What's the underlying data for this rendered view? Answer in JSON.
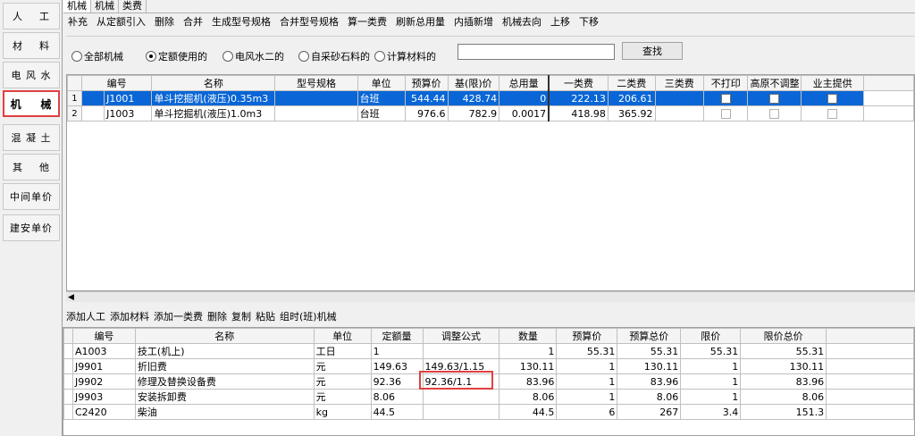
{
  "sidebar": {
    "items": [
      {
        "label": "人    工",
        "active": false
      },
      {
        "label": "材    料",
        "active": false
      },
      {
        "label": "电 风 水",
        "active": false
      },
      {
        "label": "机    械",
        "active": true
      },
      {
        "label": "混 凝 土",
        "active": false
      },
      {
        "label": "其    他",
        "active": false
      },
      {
        "label": "中间单价",
        "active": false
      },
      {
        "label": "建安单价",
        "active": false
      }
    ]
  },
  "tabs": [
    "机械",
    "机械",
    "类费"
  ],
  "toolbar": [
    "补充",
    "从定额引入",
    "删除",
    "合并",
    "生成型号规格",
    "合并型号规格",
    "算一类费",
    "刷新总用量",
    "内插新增",
    "机械去向",
    "上移",
    "下移"
  ],
  "filter": {
    "options": [
      {
        "label": "全部机械",
        "checked": false
      },
      {
        "label": "定额使用的",
        "checked": true
      },
      {
        "label": "电风水二的",
        "checked": false
      },
      {
        "label": "自采砂石料的",
        "checked": false
      },
      {
        "label": "计算材料的",
        "checked": false
      }
    ],
    "search_value": "",
    "search_button": "查找"
  },
  "machine_table": {
    "columns": [
      "编号",
      "名称",
      "型号规格",
      "单位",
      "预算价",
      "基(限)价",
      "总用量",
      "一类费",
      "二类费",
      "三类费",
      "不打印",
      "高原不调整",
      "业主提供"
    ],
    "rows": [
      {
        "index": "1",
        "code": "J1001",
        "name": "单斗挖掘机(液压)0.35m3",
        "spec": "",
        "unit": "台班",
        "budget": "544.44",
        "base": "428.74",
        "total": "0",
        "c1": "222.13",
        "c2": "206.61",
        "c3": "",
        "selected": true
      },
      {
        "index": "2",
        "code": "J1003",
        "name": "单斗挖掘机(液压)1.0m3",
        "spec": "",
        "unit": "台班",
        "budget": "976.6",
        "base": "782.9",
        "total": "0.0017",
        "c1": "418.98",
        "c2": "365.92",
        "c3": "",
        "selected": false
      }
    ]
  },
  "toolbar2": [
    "添加人工",
    "添加材料",
    "添加一类费",
    "删除",
    "复制",
    "粘贴",
    "组时(班)机械"
  ],
  "detail_table": {
    "columns": [
      "编号",
      "名称",
      "单位",
      "定额量",
      "调整公式",
      "数量",
      "预算价",
      "预算总价",
      "限价",
      "限价总价"
    ],
    "rows": [
      {
        "code": "A1003",
        "name": "技工(机上)",
        "unit": "工日",
        "quota": "1",
        "formula": "",
        "qty": "1",
        "price": "55.31",
        "total": "55.31",
        "limit": "55.31",
        "limit_total": "55.31"
      },
      {
        "code": "J9901",
        "name": "折旧费",
        "unit": "元",
        "quota": "149.63",
        "formula": "149.63/1.15",
        "qty": "130.11",
        "price": "1",
        "total": "130.11",
        "limit": "1",
        "limit_total": "130.11"
      },
      {
        "code": "J9902",
        "name": "修理及替换设备费",
        "unit": "元",
        "quota": "92.36",
        "formula": "92.36/1.1",
        "qty": "83.96",
        "price": "1",
        "total": "83.96",
        "limit": "1",
        "limit_total": "83.96"
      },
      {
        "code": "J9903",
        "name": "安装拆卸费",
        "unit": "元",
        "quota": "8.06",
        "formula": "",
        "qty": "8.06",
        "price": "1",
        "total": "8.06",
        "limit": "1",
        "limit_total": "8.06"
      },
      {
        "code": "C2420",
        "name": "柴油",
        "unit": "kg",
        "quota": "44.5",
        "formula": "",
        "qty": "44.5",
        "price": "6",
        "total": "267",
        "limit": "3.4",
        "limit_total": "151.3"
      }
    ]
  }
}
